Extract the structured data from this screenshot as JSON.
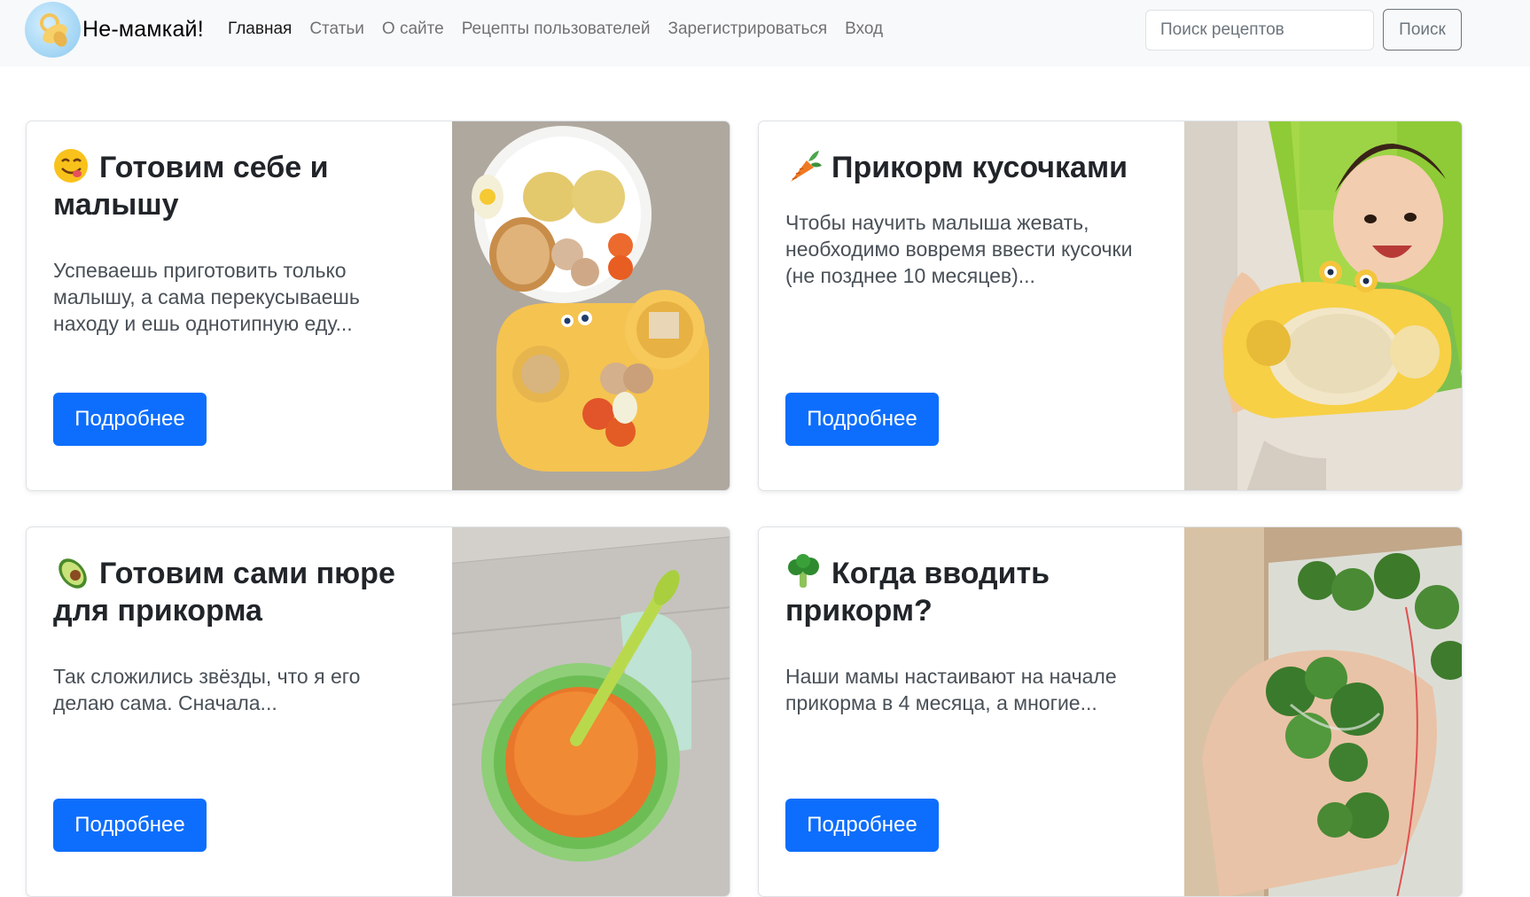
{
  "brand": {
    "name": "Не-мамкай!",
    "logo_icon": "pacifier-icon"
  },
  "nav": {
    "items": [
      {
        "label": "Главная",
        "active": true
      },
      {
        "label": "Статьи"
      },
      {
        "label": "О сайте"
      },
      {
        "label": "Рецепты пользователей"
      },
      {
        "label": "Зарегистрироваться"
      },
      {
        "label": "Вход"
      }
    ]
  },
  "search": {
    "placeholder": "Поиск рецептов",
    "button": "Поиск"
  },
  "cards": [
    {
      "emoji": "yum-face-icon",
      "title": "Готовим себе и малышу",
      "text": "Успеваешь приготовить только малышу, а сама перекусываешь находу и ешь однотипную еду...",
      "button": "Подробнее",
      "image": "plate-and-crab-bowl-photo"
    },
    {
      "emoji": "carrot-icon",
      "title": "Прикорм кусочками",
      "text": "Чтобы научить малыша жевать, необходимо вовремя ввести кусочки (не позднее 10 месяцев)...",
      "button": "Подробнее",
      "image": "baby-in-highchair-photo"
    },
    {
      "emoji": "avocado-icon",
      "title": "Готовим сами пюре для прикорма",
      "text": "Так сложились звёзды, что я его делаю сама. Сначала...",
      "button": "Подробнее",
      "image": "puree-bowl-photo"
    },
    {
      "emoji": "broccoli-icon",
      "title": "Когда вводить прикорм?",
      "text": "Наши мамы настаивают на начале прикорма в 4 месяца, а многие...",
      "button": "Подробнее",
      "image": "frozen-broccoli-photo"
    }
  ],
  "colors": {
    "primary": "#0d6efd",
    "navbar_bg": "#f8f9fa"
  }
}
